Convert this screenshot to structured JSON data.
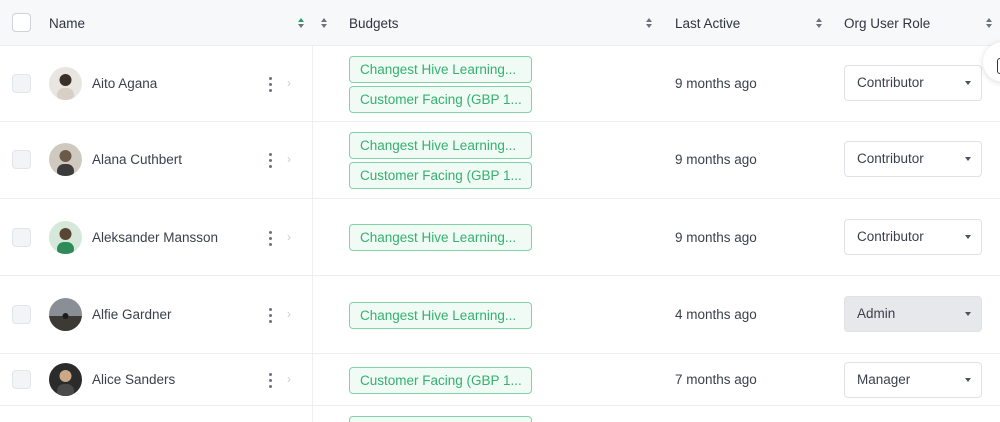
{
  "header": {
    "name": "Name",
    "budgets": "Budgets",
    "last_active": "Last Active",
    "org_user_role": "Org User Role"
  },
  "rows": [
    {
      "name": "Aito Agana",
      "budgets": [
        "Changest Hive Learning...",
        "Customer Facing (GBP 1..."
      ],
      "last_active": "9 months ago",
      "role": "Contributor"
    },
    {
      "name": "Alana Cuthbert",
      "budgets": [
        "Changest Hive Learning...",
        "Customer Facing (GBP 1..."
      ],
      "last_active": "9 months ago",
      "role": "Contributor"
    },
    {
      "name": "Aleksander Mansson",
      "budgets": [
        "Changest Hive Learning..."
      ],
      "last_active": "9 months ago",
      "role": "Contributor"
    },
    {
      "name": "Alfie Gardner",
      "budgets": [
        "Changest Hive Learning..."
      ],
      "last_active": "4 months ago",
      "role": "Admin"
    },
    {
      "name": "Alice Sanders",
      "budgets": [
        "Customer Facing (GBP 1..."
      ],
      "last_active": "7 months ago",
      "role": "Manager"
    }
  ],
  "colors": {
    "tag_border": "#7fd3a6",
    "tag_text": "#35b06f",
    "tag_bg": "#effbf4",
    "header_bg": "#f7f8fa",
    "admin_bg": "#e7e8ec"
  }
}
